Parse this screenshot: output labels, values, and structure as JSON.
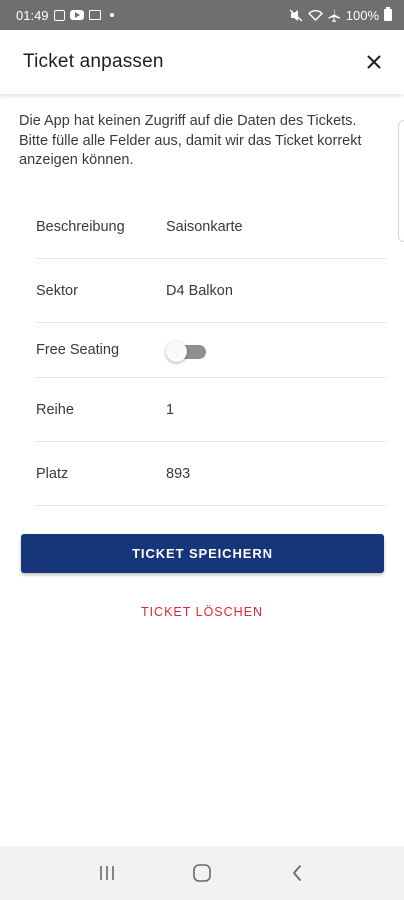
{
  "status_bar": {
    "time": "01:49",
    "battery": "100%",
    "icons": [
      "checkbox-notification-icon",
      "youtube-icon",
      "mail-icon",
      "dot-icon",
      "mute-icon",
      "wifi-icon",
      "airplane-icon",
      "battery-icon"
    ]
  },
  "header": {
    "title": "Ticket anpassen",
    "close_icon": "close-icon"
  },
  "info_text": "Die App hat keinen Zugriff auf die Daten des Tickets. Bitte fülle alle Felder aus, damit wir das Ticket korrekt anzeigen können.",
  "form": {
    "beschreibung": {
      "label": "Beschreibung",
      "value": "Saisonkarte"
    },
    "sektor": {
      "label": "Sektor",
      "value": "D4 Balkon"
    },
    "free_seating": {
      "label": "Free Seating",
      "enabled": false
    },
    "reihe": {
      "label": "Reihe",
      "value": "1"
    },
    "platz": {
      "label": "Platz",
      "value": "893"
    }
  },
  "actions": {
    "save_label": "TICKET SPEICHERN",
    "delete_label": "TICKET LÖSCHEN"
  },
  "nav_bar": {
    "icons": [
      "recent-apps-icon",
      "home-icon",
      "back-icon"
    ]
  },
  "colors": {
    "primary": "#17357a",
    "danger": "#e02835",
    "status_bar": "#6f6f6f"
  }
}
